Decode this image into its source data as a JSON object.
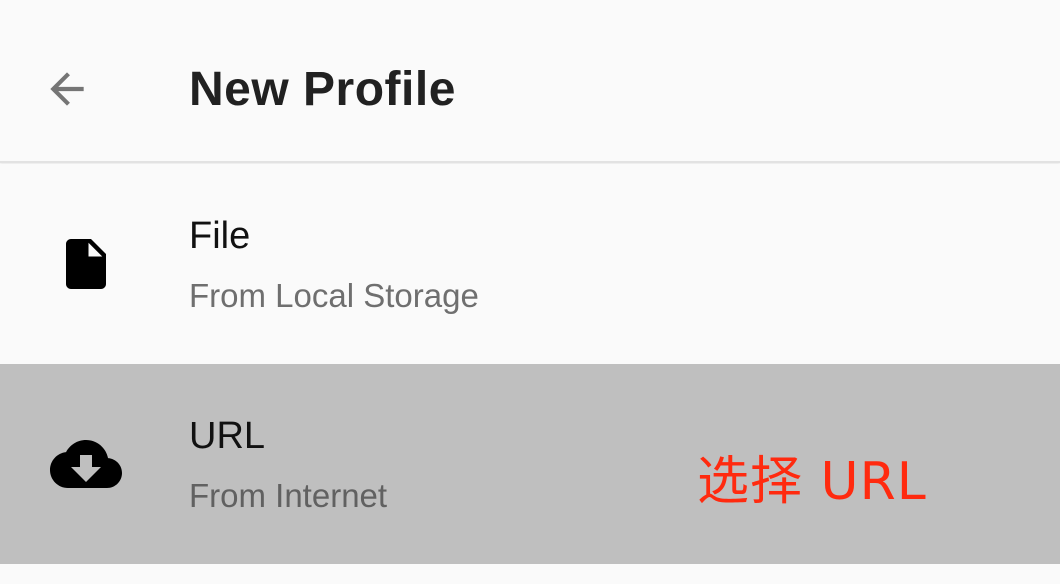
{
  "app_bar": {
    "title": "New Profile"
  },
  "items": [
    {
      "title": "File",
      "subtitle": "From Local Storage",
      "icon": "file-icon"
    },
    {
      "title": "URL",
      "subtitle": "From Internet",
      "icon": "cloud-download-icon"
    }
  ],
  "annotation": {
    "text": "选择 URL",
    "color": "#ff2a0f"
  },
  "colors": {
    "background": "#fafafa",
    "highlight": "#bfbfbf"
  }
}
